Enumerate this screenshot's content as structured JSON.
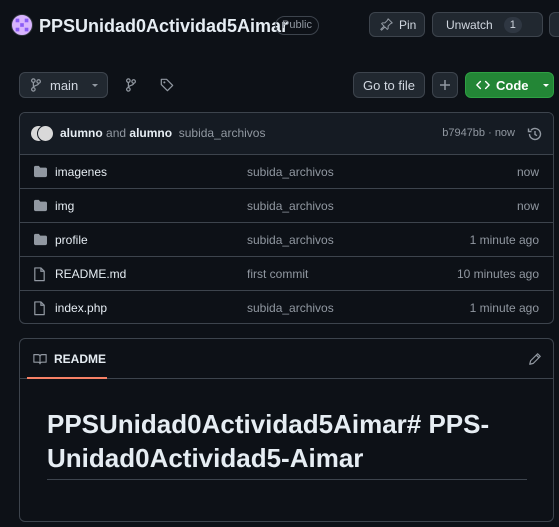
{
  "repo": {
    "name": "PPSUnidad0Actividad5Aimar",
    "visibility": "Public"
  },
  "header_actions": {
    "pin_label": "Pin",
    "watch_label": "Unwatch",
    "watch_count": "1"
  },
  "toolbar": {
    "branch": "main",
    "go_to_file": "Go to file",
    "code_label": "Code"
  },
  "latest_commit": {
    "author1": "alumno",
    "joiner": "and",
    "author2": "alumno",
    "message": "subida_archivos",
    "hash_time": "b7947bb · now"
  },
  "files": [
    {
      "name": "imagenes",
      "type": "folder",
      "message": "subida_archivos",
      "time": "now"
    },
    {
      "name": "img",
      "type": "folder",
      "message": "subida_archivos",
      "time": "now"
    },
    {
      "name": "profile",
      "type": "folder",
      "message": "subida_archivos",
      "time": "1 minute ago"
    },
    {
      "name": "README.md",
      "type": "file",
      "message": "first commit",
      "time": "10 minutes ago"
    },
    {
      "name": "index.php",
      "type": "file",
      "message": "subida_archivos",
      "time": "1 minute ago"
    }
  ],
  "readme": {
    "tab_label": "README",
    "heading": "PPSUnidad0Actividad5Aimar# PPS-Unidad0Actividad5-Aimar"
  },
  "colors": {
    "background": "#0d1117",
    "code_button": "#238636",
    "tab_underline": "#f78166"
  }
}
